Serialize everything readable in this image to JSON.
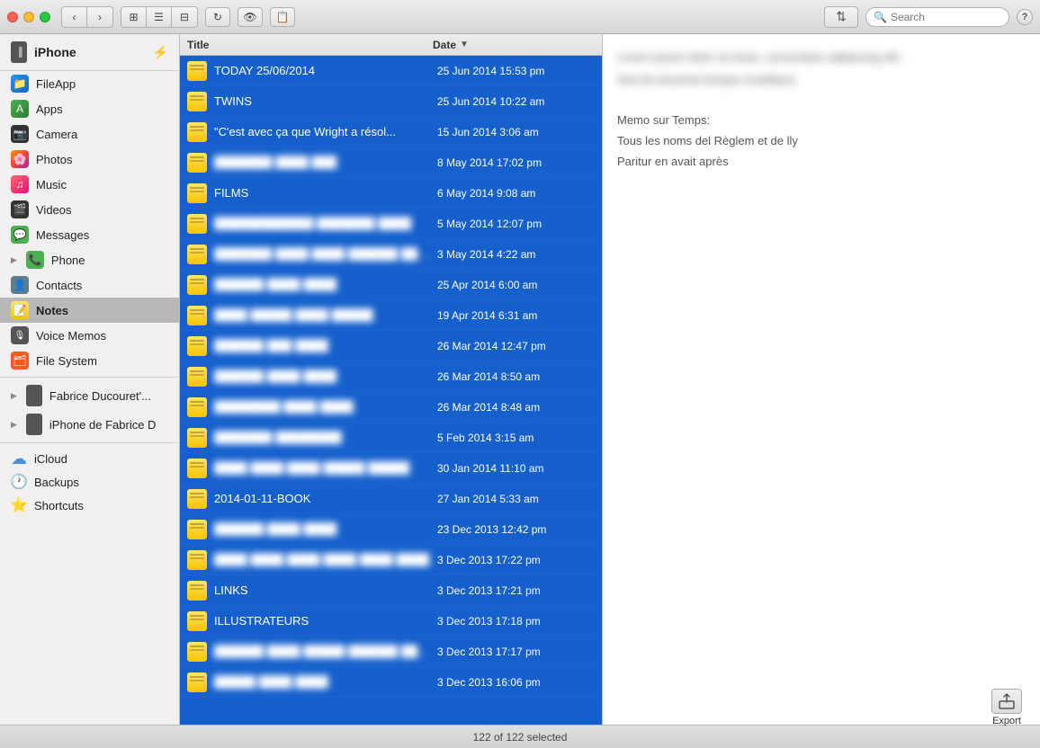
{
  "titlebar": {
    "search_placeholder": "Search",
    "help_label": "?"
  },
  "sidebar": {
    "iphone_label": "iPhone",
    "items": [
      {
        "id": "fileapp",
        "label": "FileApp",
        "icon": "📁",
        "type": "app"
      },
      {
        "id": "apps",
        "label": "Apps",
        "icon": "🟢",
        "type": "app"
      },
      {
        "id": "camera",
        "label": "Camera",
        "icon": "📷",
        "type": "app"
      },
      {
        "id": "photos",
        "label": "Photos",
        "icon": "🌸",
        "type": "app"
      },
      {
        "id": "music",
        "label": "Music",
        "icon": "🎵",
        "type": "app"
      },
      {
        "id": "videos",
        "label": "Videos",
        "icon": "🎬",
        "type": "app"
      },
      {
        "id": "messages",
        "label": "Messages",
        "icon": "💬",
        "type": "app"
      },
      {
        "id": "phone",
        "label": "Phone",
        "icon": "📞",
        "type": "app"
      },
      {
        "id": "contacts",
        "label": "Contacts",
        "icon": "👤",
        "type": "app"
      },
      {
        "id": "notes",
        "label": "Notes",
        "icon": "📝",
        "type": "app",
        "active": true
      },
      {
        "id": "voicememos",
        "label": "Voice Memos",
        "icon": "🎙",
        "type": "app"
      },
      {
        "id": "filesystem",
        "label": "File System",
        "icon": "🗂",
        "type": "app"
      }
    ],
    "other_devices": [
      {
        "id": "fabrice1",
        "label": "Fabrice Ducouret'...",
        "type": "device"
      },
      {
        "id": "fabrice2",
        "label": "iPhone de Fabrice D",
        "type": "device"
      }
    ],
    "cloud_items": [
      {
        "id": "icloud",
        "label": "iCloud",
        "icon": "☁"
      },
      {
        "id": "backups",
        "label": "Backups",
        "icon": "🕐"
      },
      {
        "id": "shortcuts",
        "label": "Shortcuts",
        "icon": "⭐"
      }
    ]
  },
  "notes_list": {
    "col_title": "Title",
    "col_date": "Date",
    "rows": [
      {
        "title": "TODAY 25/06/2014",
        "date": "25 Jun 2014 15:53 pm",
        "blurred": false
      },
      {
        "title": "TWINS",
        "date": "25 Jun 2014 10:22 am",
        "blurred": false
      },
      {
        "title": "\"C'est avec ça que Wright a résol...",
        "date": "15 Jun 2014 3:06 am",
        "blurred": false
      },
      {
        "title": "███████ ████ ███",
        "date": "8 May 2014 17:02 pm",
        "blurred": true
      },
      {
        "title": "FILMS",
        "date": "6 May 2014 9:08 am",
        "blurred": false
      },
      {
        "title": "████████████ ███████ ████",
        "date": "5 May 2014 12:07 pm",
        "blurred": true
      },
      {
        "title": "███████ ████ ████ ██████ ████",
        "date": "3 May 2014 4:22 am",
        "blurred": true
      },
      {
        "title": "██████ ████ ████",
        "date": "25 Apr 2014 6:00 am",
        "blurred": true
      },
      {
        "title": "████ █████ ████ █████",
        "date": "19 Apr 2014 6:31 am",
        "blurred": true
      },
      {
        "title": "██████ ███ ████",
        "date": "26 Mar 2014 12:47 pm",
        "blurred": true
      },
      {
        "title": "██████ ████ ████",
        "date": "26 Mar 2014 8:50 am",
        "blurred": true
      },
      {
        "title": "████████ ████ ████",
        "date": "26 Mar 2014 8:48 am",
        "blurred": true
      },
      {
        "title": "███████ ████████",
        "date": "5 Feb 2014 3:15 am",
        "blurred": true
      },
      {
        "title": "████ ████ ████ █████ █████",
        "date": "30 Jan 2014 11:10 am",
        "blurred": true
      },
      {
        "title": "2014-01-11-BOOK",
        "date": "27 Jan 2014 5:33 am",
        "blurred": false
      },
      {
        "title": "██████ ████ ████",
        "date": "23 Dec 2013 12:42 pm",
        "blurred": true
      },
      {
        "title": "████ ████ ████ ████ ████ ████",
        "date": "3 Dec 2013 17:22 pm",
        "blurred": true
      },
      {
        "title": "LINKS",
        "date": "3 Dec 2013 17:21 pm",
        "blurred": false
      },
      {
        "title": "ILLUSTRATEURS",
        "date": "3 Dec 2013 17:18 pm",
        "blurred": false
      },
      {
        "title": "██████ ████ █████ ██████ ████",
        "date": "3 Dec 2013 17:17 pm",
        "blurred": true
      },
      {
        "title": "█████ ████ ████",
        "date": "3 Dec 2013 16:06 pm",
        "blurred": true
      }
    ]
  },
  "preview": {
    "lines": [
      {
        "text": "Lorem ipsum dolor sit amet, consectetur adipiscing elit.",
        "blurred": true
      },
      {
        "text": "Sed do eiusmod tempor incididunt.",
        "blurred": true
      },
      {
        "text": "",
        "blurred": false
      },
      {
        "text": "Memo sur Temps:",
        "blurred": false
      },
      {
        "text": "Tous les noms del Règlem et de lly",
        "blurred": false
      },
      {
        "text": "Paritur en avait après",
        "blurred": false
      }
    ]
  },
  "statusbar": {
    "selected_text": "122 of 122 selected"
  },
  "export_btn": {
    "label": "Export"
  }
}
